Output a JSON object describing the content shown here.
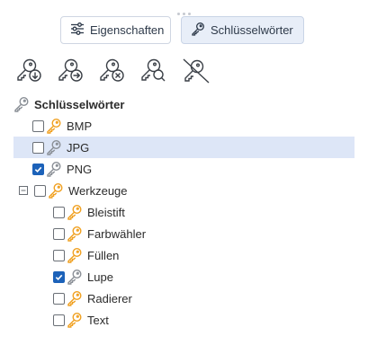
{
  "tabs": [
    {
      "label": "Eigenschaften",
      "icon": "sliders-icon",
      "active": false
    },
    {
      "label": "Schlüsselwörter",
      "icon": "key-icon",
      "active": true
    }
  ],
  "toolbar": [
    {
      "icon": "key-import-icon"
    },
    {
      "icon": "key-export-icon"
    },
    {
      "icon": "key-remove-icon"
    },
    {
      "icon": "key-search-icon"
    },
    {
      "icon": "key-disable-icon"
    }
  ],
  "tree": {
    "root": {
      "label": "Schlüsselwörter",
      "icon": "key-icon"
    },
    "items": [
      {
        "label": "BMP",
        "checked": false,
        "selected": false,
        "key_color": "orange"
      },
      {
        "label": "JPG",
        "checked": false,
        "selected": true,
        "key_color": "grey"
      },
      {
        "label": "PNG",
        "checked": true,
        "selected": false,
        "key_color": "grey"
      },
      {
        "label": "Werkzeuge",
        "checked": false,
        "selected": false,
        "key_color": "orange",
        "expanded": true,
        "children": [
          {
            "label": "Bleistift",
            "checked": false,
            "key_color": "orange"
          },
          {
            "label": "Farbwähler",
            "checked": false,
            "key_color": "orange"
          },
          {
            "label": "Füllen",
            "checked": false,
            "key_color": "orange"
          },
          {
            "label": "Lupe",
            "checked": true,
            "key_color": "grey"
          },
          {
            "label": "Radierer",
            "checked": false,
            "key_color": "orange"
          },
          {
            "label": "Text",
            "checked": false,
            "key_color": "orange"
          }
        ]
      }
    ]
  },
  "colors": {
    "accent": "#1c62b9",
    "selection": "#dde6f7",
    "key_orange": "#f0a020",
    "key_grey": "#8a8f96"
  }
}
